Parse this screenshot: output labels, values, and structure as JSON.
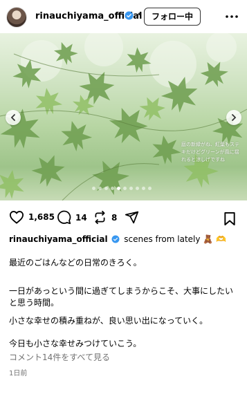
{
  "header": {
    "username": "rinauchiyama_official",
    "separator": "•",
    "follow_label": "フォロー中"
  },
  "photo": {
    "overlay_text": "庭の新緑がね、紅葉もステキだけどグリーンが風に揺れると涼しげですね",
    "slide_count": 10,
    "active_slide": 5
  },
  "actions": {
    "likes": "1,685",
    "comments": "14",
    "reposts": "8"
  },
  "caption": {
    "username": "rinauchiyama_official",
    "headline": "scenes from lately",
    "emoji": "🧸",
    "trailing": "🫶",
    "paragraphs": [
      "最近のごはんなどの日常のきろく。",
      "一日があっという間に過ぎてしまうからこそ、大事にしたいと思う時間。",
      "小さな幸せの積み重ねが、良い思い出になっていく。",
      "今日も小さな幸せみつけていこう。"
    ]
  },
  "footer": {
    "view_comments": "コメント14件をすべて見る",
    "posted": "1日前"
  },
  "colors": {
    "verified": "#3897f0",
    "secondary_text": "#737373"
  }
}
